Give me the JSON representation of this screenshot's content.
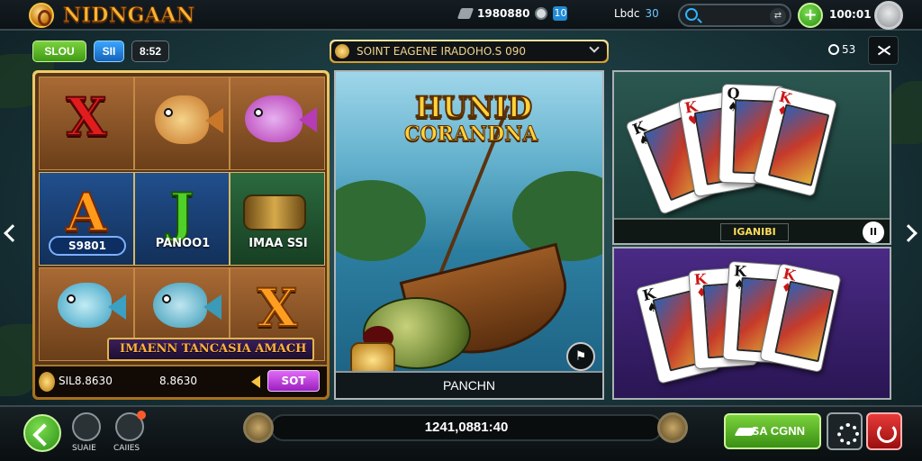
{
  "header": {
    "brand": "NIDNGAAN",
    "coins": "1980880",
    "bonus": "10",
    "level_label": "Lbdc",
    "level_value": "30",
    "search_placeholder": "",
    "balance": "100:01"
  },
  "toolbar": {
    "pill_green": "SLOU",
    "pill_blue": "SII",
    "pill_dark": "8:52",
    "banner_text": "SOINT EAGENE IRADOHO.S 090",
    "zoom_text": "53"
  },
  "slot": {
    "cell_labels": [
      "S9801",
      "PANOO1",
      "IMAA SSI"
    ],
    "row_banner": "IMAENN TANCASIA AMACH",
    "footer_value_1": "SIL8.8630",
    "footer_value_2": "8.8630",
    "footer_button": "SOT"
  },
  "feature": {
    "title_line1": "HUNID",
    "title_line2": "CORANDNA",
    "footer": "PANCHN"
  },
  "cards": {
    "top_label": "IGANIBI",
    "top_cards": [
      {
        "rank": "K",
        "suit": "♠"
      },
      {
        "rank": "K",
        "suit": "♥"
      },
      {
        "rank": "Q",
        "suit": "♠"
      },
      {
        "rank": "K",
        "suit": "♦"
      }
    ],
    "bottom_cards": [
      {
        "rank": "K",
        "suit": "♠"
      },
      {
        "rank": "K",
        "suit": "♦"
      },
      {
        "rank": "K",
        "suit": "♠"
      },
      {
        "rank": "K",
        "suit": "♦"
      }
    ]
  },
  "bottom": {
    "share_label": "SUAIE",
    "games_label": "CAIIES",
    "total": "1241,0881:40",
    "spin_label": "SA CGNN"
  },
  "colors": {
    "accent_green": "#3f9a16",
    "accent_gold": "#f6b631",
    "accent_purple": "#9b1fc0"
  }
}
